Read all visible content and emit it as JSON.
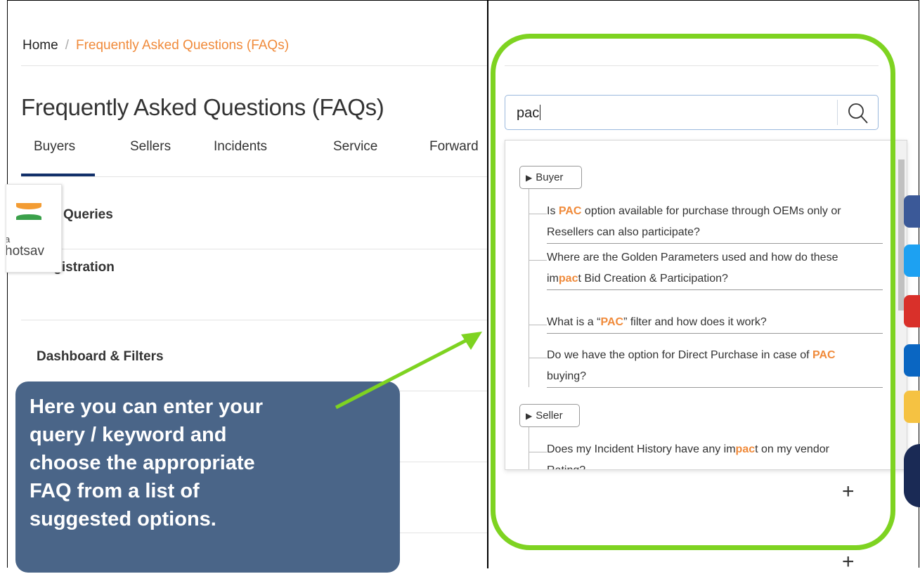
{
  "breadcrumb": {
    "home": "Home",
    "separator": "/",
    "current": "Frequently Asked Questions (FAQs)"
  },
  "page_title": "Frequently Asked Questions (FAQs)",
  "tabs": [
    "Buyers",
    "Sellers",
    "Incidents",
    "Service",
    "Forward"
  ],
  "active_tab": "Buyers",
  "sections": [
    "Queries",
    "Registration",
    "Dashboard & Filters"
  ],
  "badge": {
    "text_top": "a",
    "text_bottom": "hotsav"
  },
  "callout": {
    "lines": [
      "Here you can enter your",
      "query / keyword and",
      "choose the appropriate",
      "FAQ from a list of",
      "suggested options."
    ]
  },
  "search": {
    "value": "pac"
  },
  "results": {
    "buyer_label": "Buyer",
    "seller_label": "Seller",
    "buyer_items": [
      {
        "pre": "Is ",
        "hl": "PAC",
        "post": " option available for purchase through OEMs only or",
        "line2": "Resellers can also participate?"
      },
      {
        "pre": "Where are the Golden Parameters used and how do these",
        "line2_pre": "im",
        "line2_hl": "pac",
        "line2_post": "t Bid Creation & Participation?"
      },
      {
        "pre": "What is a “",
        "hl": "PAC",
        "post": "” filter and how does it work?"
      },
      {
        "pre": "Do we have the option for Direct Purchase in case of ",
        "hl": "PAC",
        "line2": "buying?"
      }
    ],
    "seller_items": [
      {
        "pre": "Does my Incident History have any im",
        "hl": "pac",
        "post": "t on my vendor",
        "line2": "Rating?"
      }
    ]
  },
  "colors": {
    "accent_orange": "#f08a3a",
    "tab_underline": "#12306a",
    "callout_bg": "#4a6588",
    "highlight_frame": "#7ed321"
  },
  "icons": [
    "search-icon",
    "plus-icon",
    "facebook-icon",
    "twitter-icon",
    "youtube-icon",
    "linkedin-icon",
    "koo-icon",
    "x-icon"
  ]
}
